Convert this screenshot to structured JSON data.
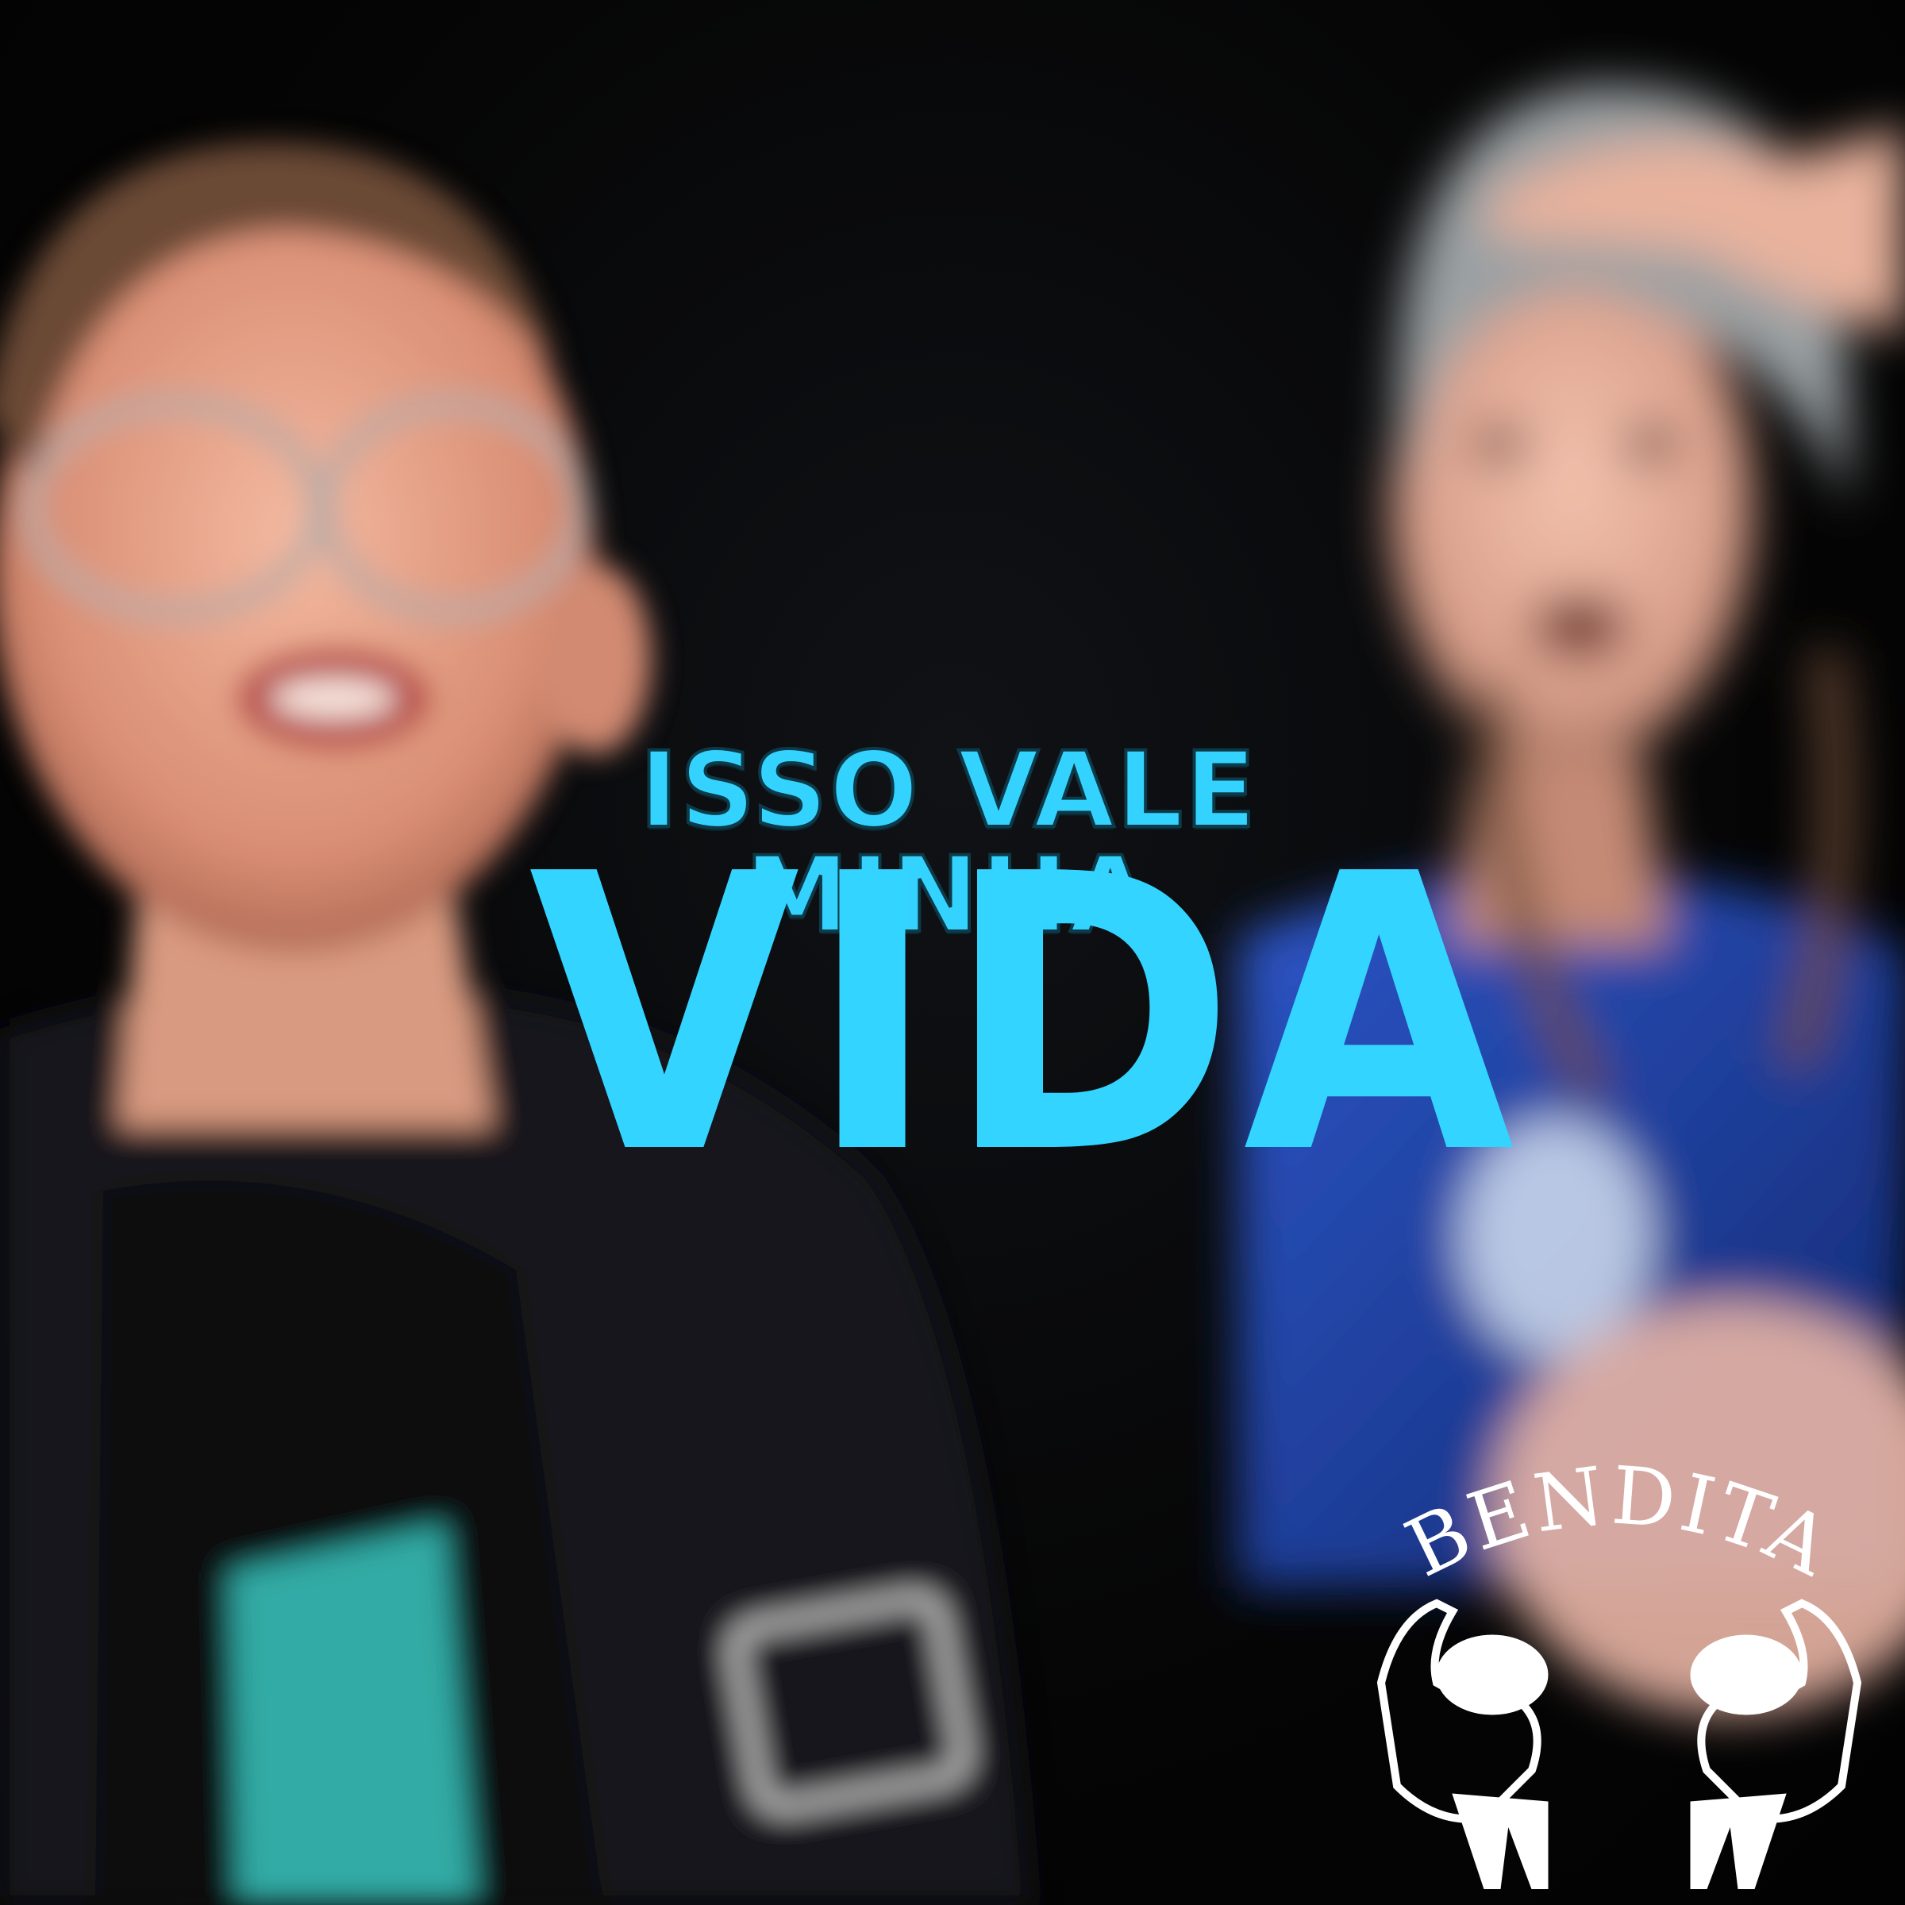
{
  "title": {
    "line1": "ISSO VALE MINHA",
    "line2": "VIDA"
  },
  "logo": {
    "text": "BENDITA",
    "icon": "two-hands-holding-globes-icon"
  },
  "colors": {
    "title": "#34d3ff",
    "background": "#050505",
    "logo": "#ffffff"
  },
  "image": {
    "description_icons": [
      "left-person-with-glasses",
      "right-person-with-beanie-and-braids"
    ]
  }
}
